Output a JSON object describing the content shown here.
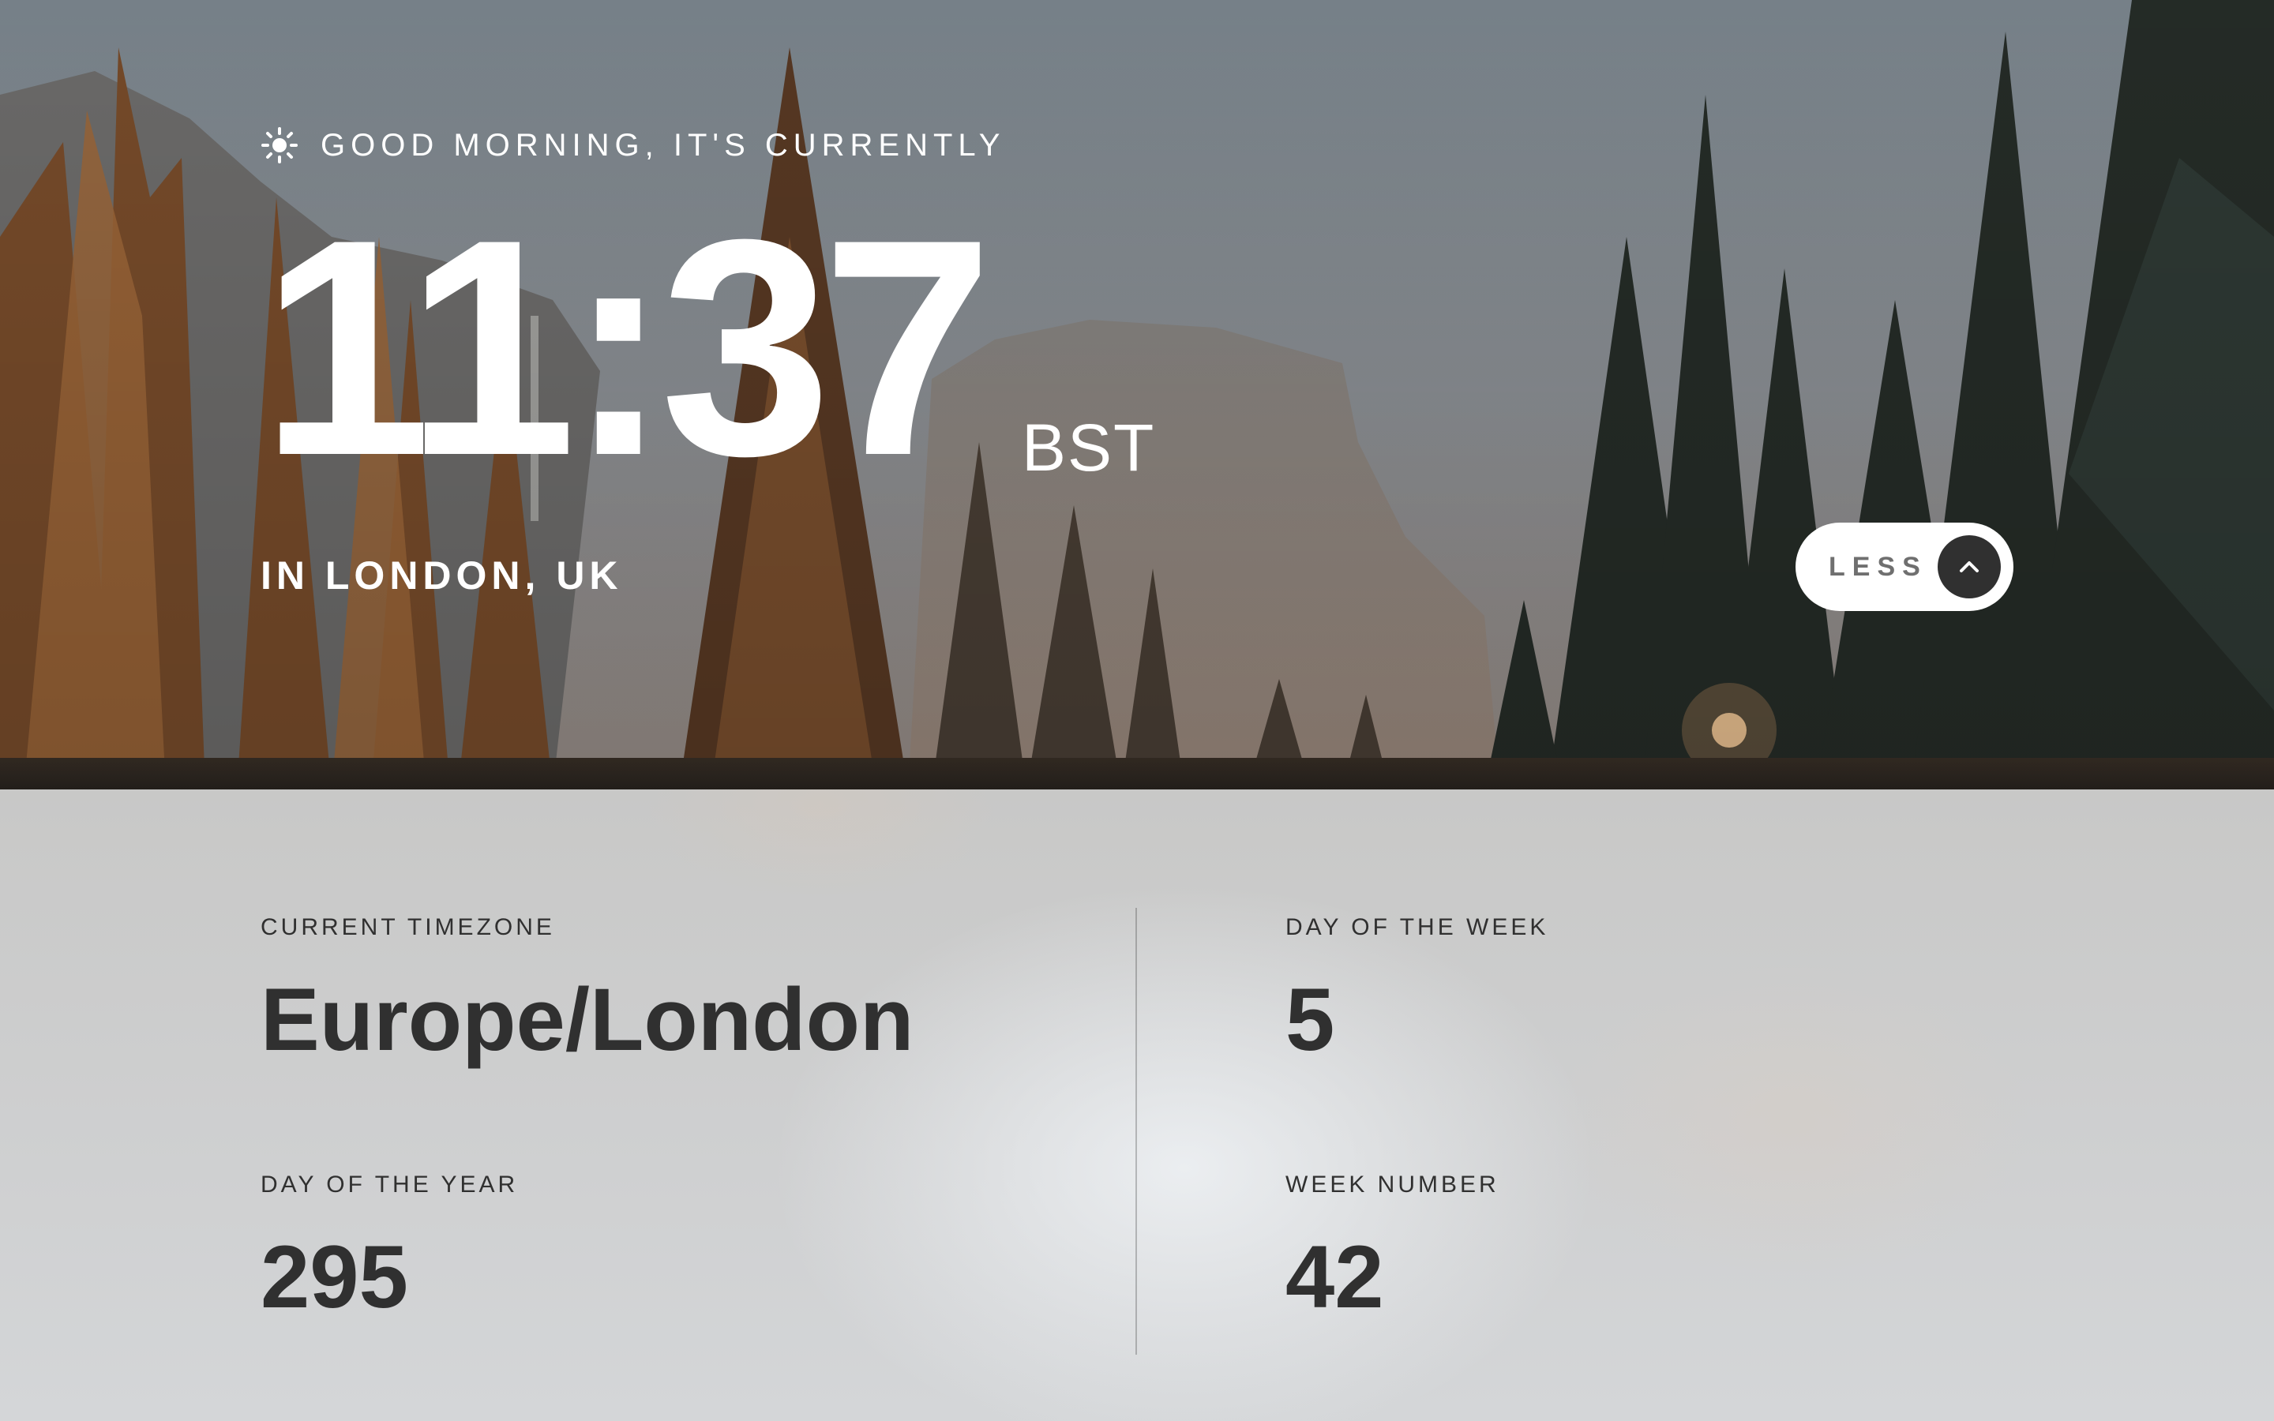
{
  "greeting": {
    "icon": "sun-icon",
    "text": "GOOD MORNING, IT'S CURRENTLY"
  },
  "clock": {
    "time": "11:37",
    "timezone_abbr": "BST"
  },
  "location": "IN LONDON, UK",
  "toggle": {
    "label": "LESS",
    "icon": "chevron-up-icon"
  },
  "details": {
    "current_timezone": {
      "label": "CURRENT TIMEZONE",
      "value": "Europe/London"
    },
    "day_of_week": {
      "label": "DAY OF THE WEEK",
      "value": "5"
    },
    "day_of_year": {
      "label": "DAY OF THE YEAR",
      "value": "295"
    },
    "week_number": {
      "label": "WEEK NUMBER",
      "value": "42"
    }
  },
  "colors": {
    "text_light": "#ffffff",
    "text_dark": "#303030",
    "button_bg": "#ffffff",
    "button_icon_bg": "#303030",
    "button_label": "#6f6f6f",
    "panel_bg": "#c9cacb"
  }
}
